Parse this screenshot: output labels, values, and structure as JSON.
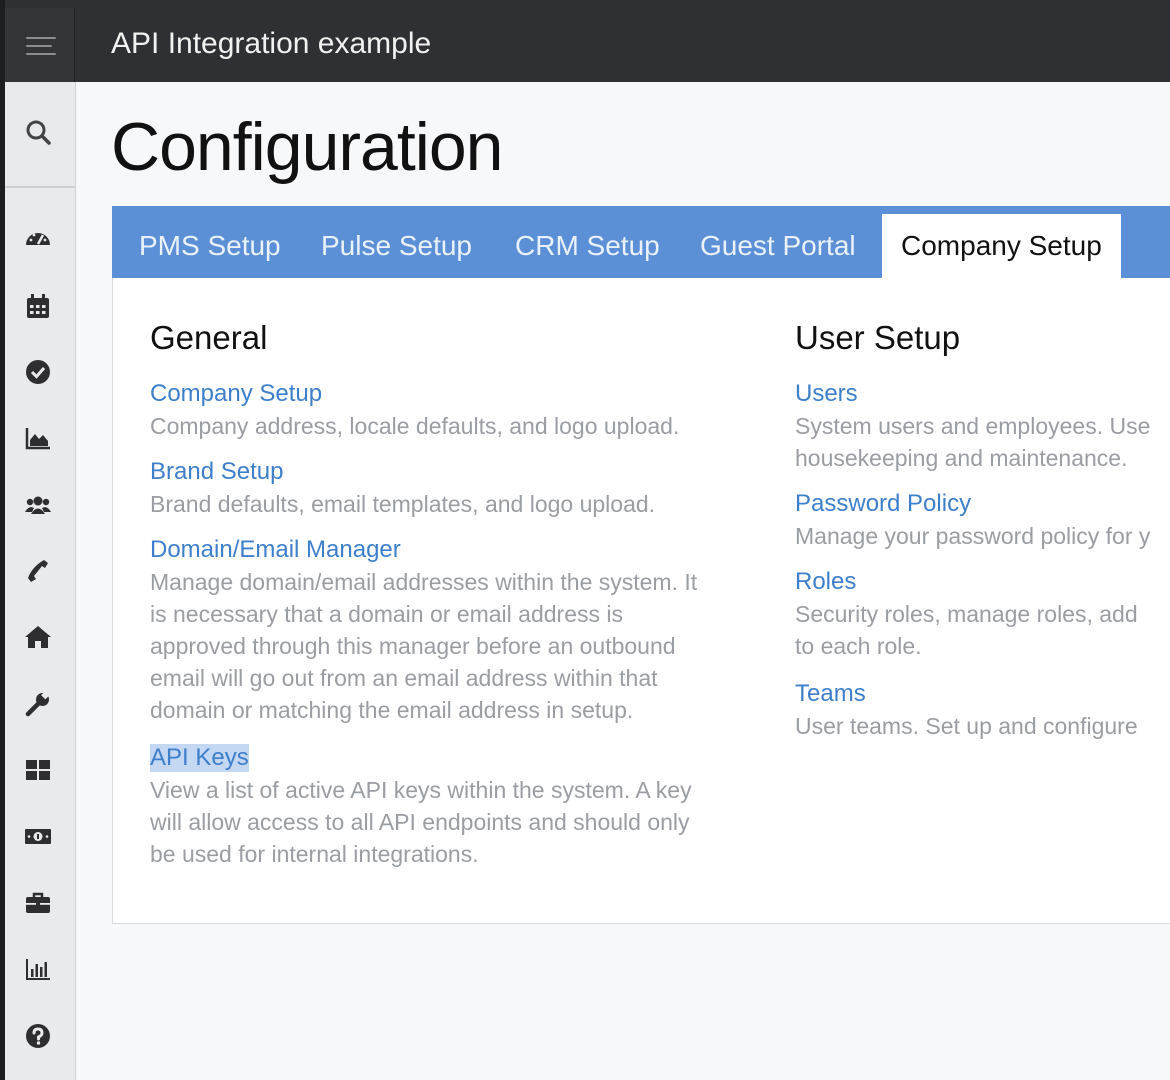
{
  "header": {
    "title": "API Integration example"
  },
  "sidebar": {
    "items": [
      {
        "icon": "search-icon"
      },
      {
        "icon": "dashboard-gauge-icon"
      },
      {
        "icon": "calendar-icon"
      },
      {
        "icon": "check-circle-icon"
      },
      {
        "icon": "area-chart-icon"
      },
      {
        "icon": "users-icon"
      },
      {
        "icon": "phone-icon"
      },
      {
        "icon": "home-icon"
      },
      {
        "icon": "wrench-icon"
      },
      {
        "icon": "grid-icon"
      },
      {
        "icon": "money-icon"
      },
      {
        "icon": "briefcase-icon"
      },
      {
        "icon": "bar-chart-icon"
      },
      {
        "icon": "help-icon"
      }
    ]
  },
  "page": {
    "title": "Configuration"
  },
  "tabs": [
    {
      "label": "PMS Setup"
    },
    {
      "label": "Pulse Setup"
    },
    {
      "label": "CRM Setup"
    },
    {
      "label": "Guest Portal"
    },
    {
      "label": "Company Setup",
      "active": true
    }
  ],
  "general": {
    "title": "General",
    "items": [
      {
        "link": "Company Setup",
        "desc": [
          "Company address, locale defaults, and logo upload."
        ]
      },
      {
        "link": "Brand Setup",
        "desc": [
          "Brand defaults, email templates, and logo upload."
        ]
      },
      {
        "link": "Domain/Email Manager",
        "desc": [
          "Manage domain/email addresses within the system. It",
          "is necessary that a domain or email address is",
          "approved through this manager before an outbound",
          "email will go out from an email address within that",
          "domain or matching the email address in setup."
        ]
      },
      {
        "link": "API Keys",
        "desc": [
          "View a list of active API keys within the system. A key",
          "will allow access to all API endpoints and should only",
          "be used for internal integrations."
        ]
      }
    ]
  },
  "user_setup": {
    "title": "User Setup",
    "items": [
      {
        "link": "Users",
        "desc": [
          "System users and employees. Use",
          "housekeeping and maintenance."
        ]
      },
      {
        "link": "Password Policy",
        "desc": [
          "Manage your password policy for y"
        ]
      },
      {
        "link": "Roles",
        "desc": [
          "Security roles, manage roles, add",
          "to each role."
        ]
      },
      {
        "link": "Teams",
        "desc": [
          "User teams. Set up and configure"
        ]
      }
    ]
  },
  "colors": {
    "accent": "#5b90d6",
    "link": "#3d7fcb",
    "topbar": "#2f3033",
    "sidebar": "#e9eaec"
  }
}
